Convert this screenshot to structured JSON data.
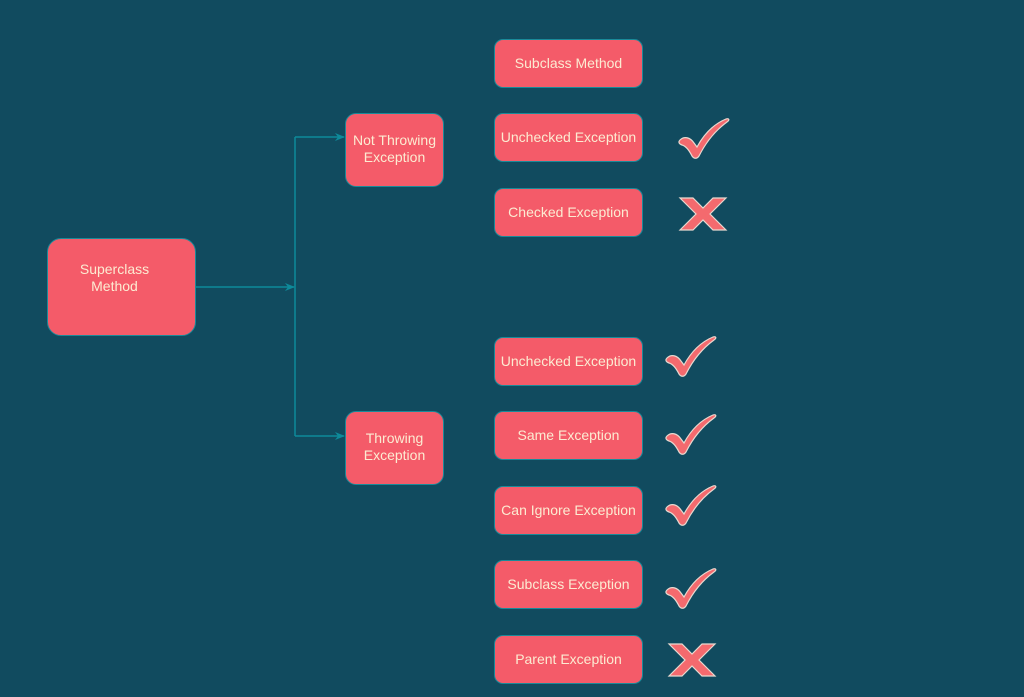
{
  "colors": {
    "background": "#114B5F",
    "node_fill": "#F45B69",
    "node_border": "#1A8A99",
    "node_text": "#FCEBD2",
    "connector": "#0E8A9A",
    "mark_fill": "#F46A6E",
    "mark_outline": "#E8D9D0"
  },
  "root": {
    "label_line1": "Superclass",
    "label_line2": "Method"
  },
  "branches": [
    {
      "label_line1": "Not Throwing",
      "label_line2": "Exception"
    },
    {
      "label_line1": "Throwing",
      "label_line2": "Exception"
    }
  ],
  "items": [
    {
      "label": "Subclass Method",
      "mark": "none"
    },
    {
      "label": "Unchecked Exception",
      "mark": "check"
    },
    {
      "label": "Checked Exception",
      "mark": "cross"
    },
    {
      "label": "Unchecked Exception",
      "mark": "check"
    },
    {
      "label": "Same Exception",
      "mark": "check"
    },
    {
      "label": "Can Ignore Exception",
      "mark": "check"
    },
    {
      "label": "Subclass Exception",
      "mark": "check"
    },
    {
      "label": "Parent Exception",
      "mark": "cross"
    }
  ]
}
